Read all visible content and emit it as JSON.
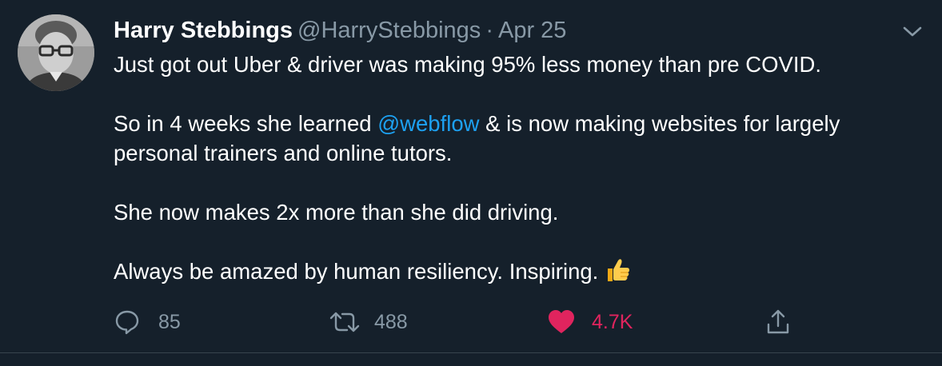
{
  "user": {
    "name": "Harry Stebbings",
    "handle": "@HarryStebbings",
    "separator": "·",
    "date": "Apr 25"
  },
  "tweet": {
    "line1": "Just got out Uber & driver was making 95% less money than pre COVID.",
    "line2_before": "So in 4 weeks she learned ",
    "mention": "@webflow",
    "line2_after": " & is now making websites for largely personal trainers and online tutors.",
    "line3": "She now makes 2x more than she did driving.",
    "line4": "Always be amazed by human resiliency. Inspiring.",
    "emoji": "thumbs-up-emoji"
  },
  "actions": {
    "reply_count": "85",
    "retweet_count": "488",
    "like_count": "4.7K"
  },
  "colors": {
    "background": "#15202b",
    "text": "#ffffff",
    "muted": "#8899a6",
    "link": "#1da1f2",
    "like": "#e0245e",
    "divider": "#38444d"
  },
  "icons": [
    "avatar-photo",
    "chevron-down-icon",
    "reply-icon",
    "retweet-icon",
    "heart-icon",
    "share-icon"
  ]
}
